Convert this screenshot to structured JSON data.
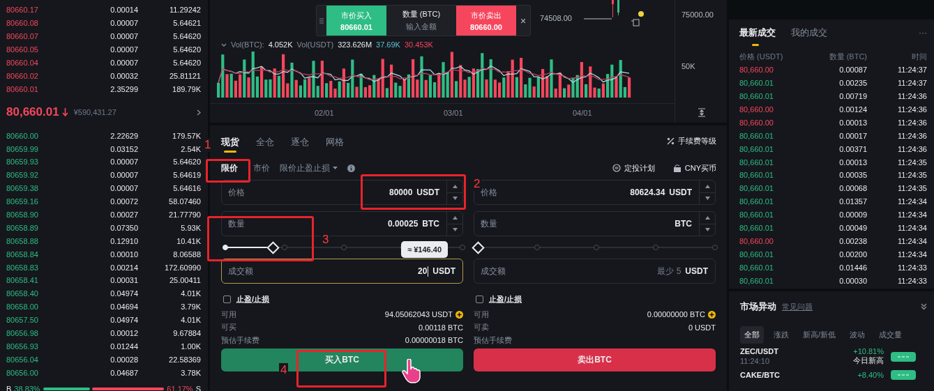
{
  "order_book": {
    "asks": [
      {
        "price": "80660.17",
        "amount": "0.00014",
        "total": "11.29242"
      },
      {
        "price": "80660.08",
        "amount": "0.00007",
        "total": "5.64621"
      },
      {
        "price": "80660.07",
        "amount": "0.00007",
        "total": "5.64620"
      },
      {
        "price": "80660.05",
        "amount": "0.00007",
        "total": "5.64620"
      },
      {
        "price": "80660.04",
        "amount": "0.00007",
        "total": "5.64620"
      },
      {
        "price": "80660.02",
        "amount": "0.00032",
        "total": "25.81121"
      },
      {
        "price": "80660.01",
        "amount": "2.35299",
        "total": "189.79K"
      }
    ],
    "last_price": "80,660.01",
    "last_price_cny": "¥590,431.27",
    "bids": [
      {
        "price": "80660.00",
        "amount": "2.22629",
        "total": "179.57K"
      },
      {
        "price": "80659.99",
        "amount": "0.03152",
        "total": "2.54K"
      },
      {
        "price": "80659.93",
        "amount": "0.00007",
        "total": "5.64620"
      },
      {
        "price": "80659.92",
        "amount": "0.00007",
        "total": "5.64619"
      },
      {
        "price": "80659.38",
        "amount": "0.00007",
        "total": "5.64616"
      },
      {
        "price": "80659.16",
        "amount": "0.00072",
        "total": "58.07460"
      },
      {
        "price": "80658.90",
        "amount": "0.00027",
        "total": "21.77790"
      },
      {
        "price": "80658.89",
        "amount": "0.07350",
        "total": "5.93K"
      },
      {
        "price": "80658.88",
        "amount": "0.12910",
        "total": "10.41K"
      },
      {
        "price": "80658.84",
        "amount": "0.00010",
        "total": "8.06588"
      },
      {
        "price": "80658.83",
        "amount": "0.00214",
        "total": "172.60990"
      },
      {
        "price": "80658.41",
        "amount": "0.00031",
        "total": "25.00411"
      },
      {
        "price": "80658.40",
        "amount": "0.04974",
        "total": "4.01K"
      },
      {
        "price": "80658.00",
        "amount": "0.04694",
        "total": "3.79K"
      },
      {
        "price": "80657.50",
        "amount": "0.04974",
        "total": "4.01K"
      },
      {
        "price": "80656.98",
        "amount": "0.00012",
        "total": "9.67884"
      },
      {
        "price": "80656.93",
        "amount": "0.01244",
        "total": "1.00K"
      },
      {
        "price": "80656.04",
        "amount": "0.00028",
        "total": "22.58369"
      },
      {
        "price": "80656.00",
        "amount": "0.04687",
        "total": "3.78K"
      }
    ],
    "ratio": {
      "buy_label": "B",
      "buy": "38.83%",
      "sell": "61.17%",
      "sell_label": "S",
      "level": 0.3883
    }
  },
  "chart": {
    "price_tick": "75000.00",
    "low_label": "74508.00",
    "volume_tick": "50K",
    "x_labels": [
      "02/01",
      "03/01",
      "04/01"
    ],
    "legend": [
      {
        "kind": "label",
        "text": "Vol(BTC):"
      },
      {
        "kind": "value",
        "text": "4.052K"
      },
      {
        "kind": "label",
        "text": "Vol(USDT)"
      },
      {
        "kind": "value",
        "text": "323.626M"
      },
      {
        "kind": "ma1",
        "text": "37.69K"
      },
      {
        "kind": "ma2",
        "text": "30.453K"
      }
    ],
    "quick_trade": {
      "buy_label": "市价买入",
      "buy_price": "80660.01",
      "amount_label": "数量 (BTC)",
      "amount_placeholder": "输入金额",
      "sell_label": "市价卖出",
      "sell_price": "80660.00",
      "close": "×"
    }
  },
  "trade_tabs": [
    {
      "label": "现货",
      "selected": true
    },
    {
      "label": "全仓",
      "selected": false
    },
    {
      "label": "逐仓",
      "selected": false
    },
    {
      "label": "网格",
      "selected": false
    }
  ],
  "fee_link": "手续费等级",
  "order_types": [
    {
      "label": "限价",
      "selected": true,
      "dropdown": false
    },
    {
      "label": "市价",
      "selected": false,
      "dropdown": false
    },
    {
      "label": "限价止盈止损",
      "selected": false,
      "dropdown": true
    }
  ],
  "plan_link": "定投计划",
  "buy_crypto_link": "CNY买币",
  "forms": [
    {
      "kind": "buy",
      "fields": [
        {
          "kind": "stepper",
          "label": "价格",
          "value": "80000",
          "unit": "USDT",
          "focused": false
        },
        {
          "kind": "stepper",
          "label": "数量",
          "value": "0.00025",
          "unit": "BTC",
          "focused": false
        },
        {
          "kind": "plain",
          "label": "成交额",
          "value": "20",
          "unit": "USDT",
          "focused": true
        }
      ],
      "slider": {
        "level": 0.2
      },
      "tooltip": "≈ ¥146.40",
      "tp_sl": {
        "label": "止盈/止损",
        "checked": false
      },
      "info": [
        {
          "kind": "balance",
          "label": "可用",
          "value": "94.05062043 USDT"
        },
        {
          "kind": "plain",
          "label": "可买",
          "value": "0.00118 BTC"
        },
        {
          "kind": "plain",
          "label": "预估手续费",
          "value": "0.00000018 BTC"
        }
      ],
      "button": "买入BTC"
    },
    {
      "kind": "sell",
      "fields": [
        {
          "kind": "stepper",
          "label": "价格",
          "value": "80624.34",
          "unit": "USDT",
          "focused": false
        },
        {
          "kind": "stepper",
          "label": "数量",
          "unit": "BTC",
          "focused": false
        },
        {
          "kind": "plain",
          "label": "成交额",
          "placeholder": "最少 5",
          "unit": "USDT",
          "focused": false
        }
      ],
      "slider": {
        "level": 0
      },
      "tp_sl": {
        "label": "止盈/止损",
        "checked": false
      },
      "info": [
        {
          "kind": "balance",
          "label": "可用",
          "value": "0.00000000 BTC"
        },
        {
          "kind": "plain",
          "label": "可卖",
          "value": "0 USDT"
        },
        {
          "kind": "plain",
          "label": "预估手续费"
        }
      ],
      "button": "卖出BTC"
    }
  ],
  "trades": {
    "tabs": [
      {
        "label": "最新成交",
        "selected": true
      },
      {
        "label": "我的成交",
        "selected": false
      }
    ],
    "more": "···",
    "columns": [
      "价格 (USDT)",
      "数量 (BTC)",
      "时间"
    ],
    "rows": [
      {
        "kind": "sell",
        "price": "80,660.00",
        "amount": "0.00087",
        "time": "11:24:37"
      },
      {
        "kind": "buy",
        "price": "80,660.01",
        "amount": "0.00235",
        "time": "11:24:37"
      },
      {
        "kind": "buy",
        "price": "80,660.01",
        "amount": "0.00719",
        "time": "11:24:36"
      },
      {
        "kind": "sell",
        "price": "80,660.00",
        "amount": "0.00124",
        "time": "11:24:36"
      },
      {
        "kind": "sell",
        "price": "80,660.00",
        "amount": "0.00013",
        "time": "11:24:36"
      },
      {
        "kind": "buy",
        "price": "80,660.01",
        "amount": "0.00017",
        "time": "11:24:36"
      },
      {
        "kind": "buy",
        "price": "80,660.01",
        "amount": "0.00371",
        "time": "11:24:36"
      },
      {
        "kind": "buy",
        "price": "80,660.01",
        "amount": "0.00013",
        "time": "11:24:35"
      },
      {
        "kind": "buy",
        "price": "80,660.01",
        "amount": "0.00035",
        "time": "11:24:35"
      },
      {
        "kind": "buy",
        "price": "80,660.01",
        "amount": "0.00068",
        "time": "11:24:35"
      },
      {
        "kind": "buy",
        "price": "80,660.01",
        "amount": "0.01357",
        "time": "11:24:34"
      },
      {
        "kind": "buy",
        "price": "80,660.01",
        "amount": "0.00009",
        "time": "11:24:34"
      },
      {
        "kind": "buy",
        "price": "80,660.01",
        "amount": "0.00049",
        "time": "11:24:34"
      },
      {
        "kind": "sell",
        "price": "80,660.00",
        "amount": "0.00238",
        "time": "11:24:34"
      },
      {
        "kind": "buy",
        "price": "80,660.01",
        "amount": "0.00200",
        "time": "11:24:34"
      },
      {
        "kind": "buy",
        "price": "80,660.01",
        "amount": "0.01446",
        "time": "11:24:33"
      },
      {
        "kind": "buy",
        "price": "80,660.01",
        "amount": "0.00030",
        "time": "11:24:33"
      }
    ]
  },
  "market_moves": {
    "title": "市场异动",
    "help_link": "常见问题",
    "filters": [
      {
        "label": "全部",
        "selected": true
      },
      {
        "label": "涨跌",
        "selected": false
      },
      {
        "label": "新高/新低",
        "selected": false
      },
      {
        "label": "波动",
        "selected": false
      },
      {
        "label": "成交量",
        "selected": false
      }
    ],
    "items": [
      {
        "pair": "ZEC/USDT",
        "time": "11:24:10",
        "change": "+10.81%",
        "note": "今日新高"
      },
      {
        "pair": "CAKE/BTC",
        "change": "+8.40%"
      }
    ]
  },
  "annotations": [
    {
      "label": "1"
    },
    {
      "label": "2"
    },
    {
      "label": "3"
    },
    {
      "label": "4"
    }
  ]
}
